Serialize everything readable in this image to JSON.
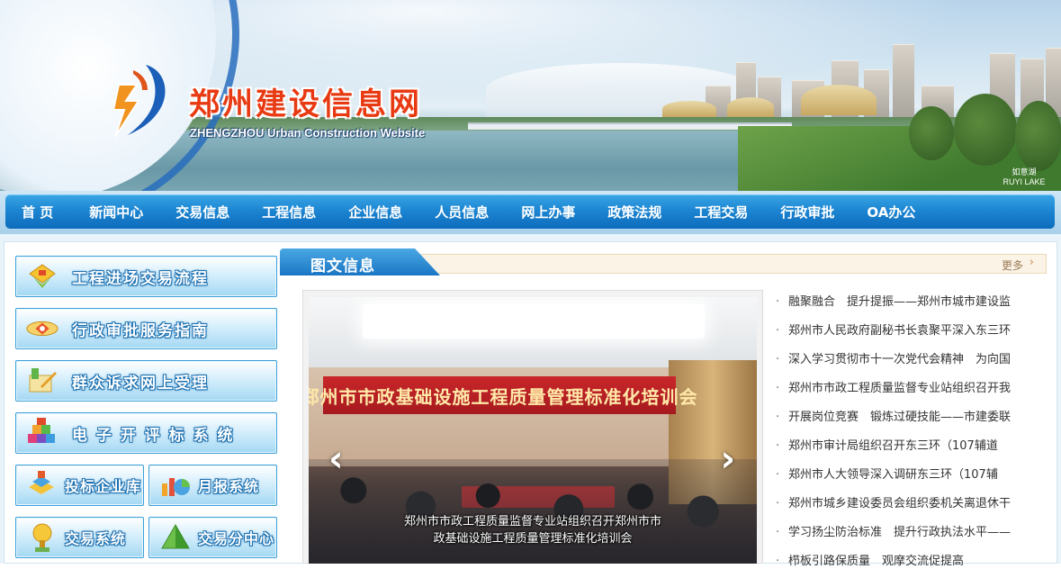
{
  "header": {
    "site_title_cn": "郑州建设信息网",
    "site_title_en": "ZHENGZHOU Urban Construction Website",
    "corner_label_cn": "如意湖",
    "corner_label_en": "RUYI LAKE"
  },
  "nav": {
    "items": [
      {
        "label": "首 页"
      },
      {
        "label": "新闻中心"
      },
      {
        "label": "交易信息"
      },
      {
        "label": "工程信息"
      },
      {
        "label": "企业信息"
      },
      {
        "label": "人员信息"
      },
      {
        "label": "网上办事"
      },
      {
        "label": "政策法规"
      },
      {
        "label": "工程交易"
      },
      {
        "label": "行政审批"
      },
      {
        "label": "OA办公"
      }
    ]
  },
  "sidebar": {
    "wide_buttons": [
      {
        "label": "工程进场交易流程",
        "icon": "diamond-certificate-icon"
      },
      {
        "label": "行政审批服务指南",
        "icon": "eye-diamond-icon"
      },
      {
        "label": "群众诉求网上受理",
        "icon": "pencil-document-icon"
      },
      {
        "label": "电 子 开 评 标 系 统",
        "icon": "cubes-icon"
      }
    ],
    "half_buttons": [
      {
        "label": "投标企业库",
        "icon": "building-blocks-icon"
      },
      {
        "label": "月报系统",
        "icon": "pie-chart-icon"
      },
      {
        "label": "交易系统",
        "icon": "trophy-icon"
      },
      {
        "label": "交易分中心",
        "icon": "pyramid-icon"
      }
    ]
  },
  "section": {
    "title": "图文信息",
    "more_label": "更多",
    "more_icon": "chevron-right-icon"
  },
  "slideshow": {
    "photo_banner_text": "郑州市市政基础设施工程质量管理标准化培训会",
    "caption_line1": "郑州市市政工程质量监督专业站组织召开郑州市市",
    "caption_line2": "政基础设施工程质量管理标准化培训会",
    "prev_icon": "chevron-left-icon",
    "next_icon": "chevron-right-icon"
  },
  "news": {
    "items": [
      "融聚融合　提升提振——郑州市城市建设监",
      "郑州市人民政府副秘书长袁聚平深入东三环",
      "深入学习贯彻市十一次党代会精神　为向国",
      "郑州市市政工程质量监督专业站组织召开我",
      "开展岗位竞赛　锻炼过硬技能——市建委联",
      "郑州市审计局组织召开东三环（107辅道",
      "郑州市人大领导深入调研东三环（107辅",
      "郑州市城乡建设委员会组织委机关离退休干",
      "学习扬尘防治标准　提升行政执法水平——",
      "栉板引路保质量　观摩交流促提高"
    ]
  },
  "colors": {
    "nav_blue": "#1d86d2",
    "title_red": "#e83a12",
    "sidebar_border": "#3d9fd8"
  }
}
